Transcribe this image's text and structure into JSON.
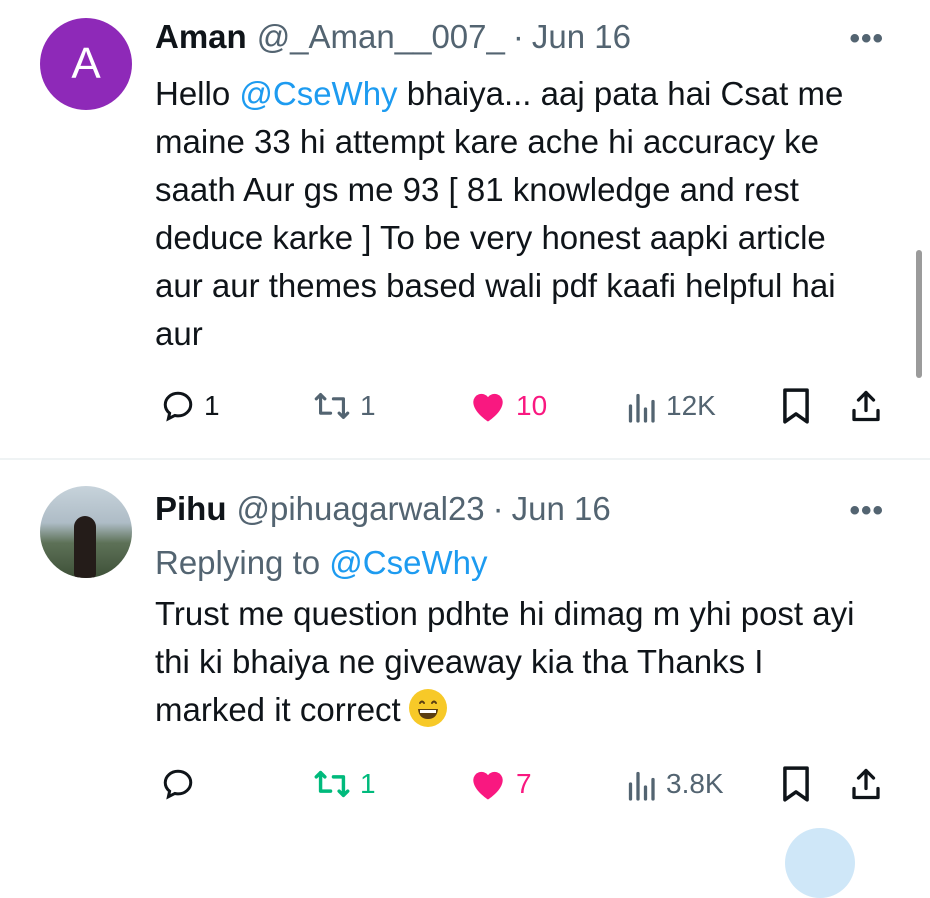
{
  "tweets": [
    {
      "avatar_letter": "A",
      "name": "Aman",
      "handle": "@_Aman__007_",
      "dot": "·",
      "date": "Jun 16",
      "more": "•••",
      "text_before": "Hello ",
      "mention": "@CseWhy",
      "text_after": "  bhaiya... aaj pata hai Csat me maine 33 hi attempt kare ache hi accuracy ke saath Aur gs me 93 [ 81 knowledge and rest deduce karke ]  To be very honest aapki article aur aur themes based wali pdf kaafi helpful hai aur",
      "replies": "1",
      "retweets": "1",
      "likes": "10",
      "views": "12K"
    },
    {
      "name": "Pihu",
      "handle": "@pihuagarwal23",
      "dot": "·",
      "date": "Jun 16",
      "more": "•••",
      "replying_prefix": "Replying to ",
      "replying_to": "@CseWhy",
      "text": "Trust me question pdhte hi dimag m yhi post ayi thi ki bhaiya ne giveaway kia tha Thanks I marked it correct",
      "emoji": "grinning-face-emoji",
      "retweets": "1",
      "likes": "7",
      "views": "3.8K"
    }
  ],
  "colors": {
    "like_pink": "#f91880",
    "retweet_green": "#00ba7c",
    "mention_blue": "#1d9bf0",
    "muted": "#536471",
    "avatar_purple": "#8e29b8"
  }
}
